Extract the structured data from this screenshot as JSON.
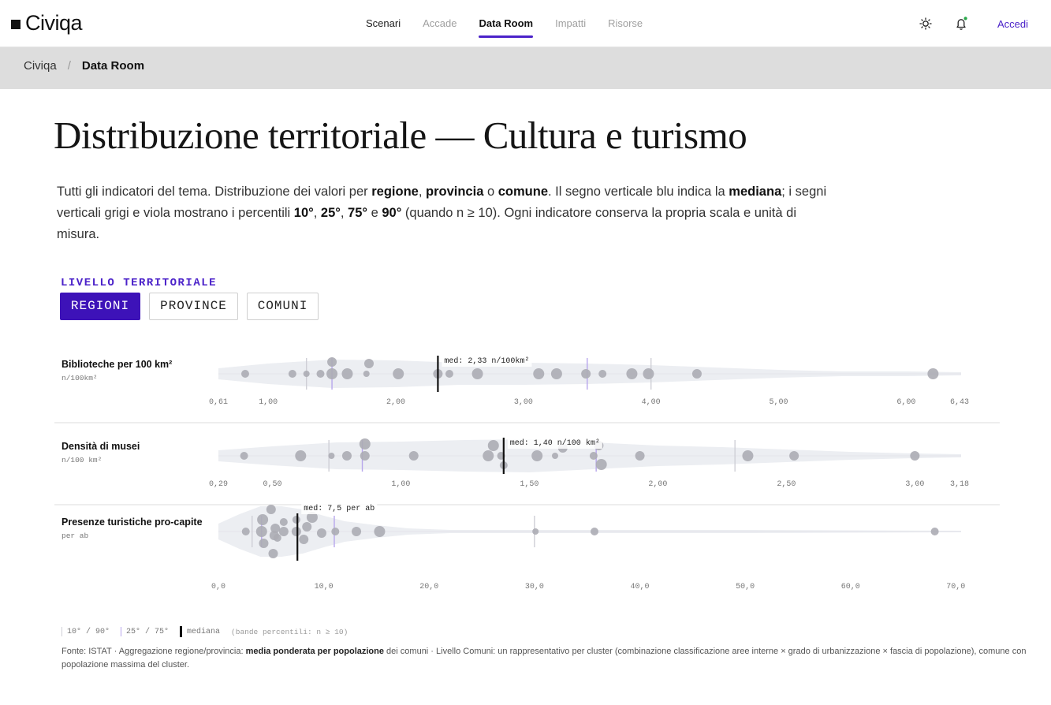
{
  "brand": {
    "name": "Civiqa"
  },
  "nav": {
    "items": [
      {
        "label": "Scenari",
        "state": "dark"
      },
      {
        "label": "Accade",
        "state": "muted"
      },
      {
        "label": "Data Room",
        "state": "active"
      },
      {
        "label": "Impatti",
        "state": "muted"
      },
      {
        "label": "Risorse",
        "state": "muted"
      }
    ],
    "login_label": "Accedi",
    "accent_color": "#4b22c9"
  },
  "icons": {
    "theme": "sun-icon",
    "notifications": "bell-icon",
    "notification_dot_color": "#2aa84a"
  },
  "breadcrumb": {
    "home": "Civiqa",
    "separator": "/",
    "current": "Data Room"
  },
  "page": {
    "title": "Distribuzione territoriale — Cultura e turismo",
    "intro": {
      "t1": "Tutti gli indicatori del tema. Distribuzione dei valori per ",
      "b1": "regione",
      "t2": ", ",
      "b2": "provincia",
      "t3": " o ",
      "b3": "comune",
      "t4": ". Il segno verticale blu indica la ",
      "b4": "mediana",
      "t5": "; i segni verticali grigi e viola mostrano i percentili ",
      "b5": "10°",
      "t6": ", ",
      "b6": "25°",
      "t7": ", ",
      "b7": "75°",
      "t8": " e ",
      "b8": "90°",
      "t9": " (quando n ≥ 10). Ogni indicatore conserva la propria scala e unità di misura."
    }
  },
  "level": {
    "label": "LIVELLO TERRITORIALE",
    "options": [
      "REGIONI",
      "PROVINCE",
      "COMUNI"
    ],
    "selected": "REGIONI"
  },
  "chart_data": {
    "type": "scatter",
    "subtype": "beeswarm-violin",
    "colors": {
      "dot": "#acacb4",
      "violin": "#eceef2",
      "median": "#111111",
      "p10_p90": "#cfcfd6",
      "p25_p75": "#b7a6ec"
    },
    "indicators": [
      {
        "name": "Biblioteche per 100 km²",
        "unit": "n/100km²",
        "xlim": [
          0.61,
          6.43
        ],
        "ticks": [
          0.61,
          1.0,
          2.0,
          3.0,
          4.0,
          5.0,
          6.0,
          6.43
        ],
        "tick_labels": [
          "0,61",
          "1,00",
          "2,00",
          "3,00",
          "4,00",
          "5,00",
          "6,00",
          "6,43"
        ],
        "median": 2.33,
        "median_label": "med: 2,33 n/100km²",
        "percentiles": {
          "p10": 1.3,
          "p25": 1.5,
          "p75": 3.5,
          "p90": 4.0
        },
        "violin_halfwidth": [
          [
            0.61,
            7
          ],
          [
            1.0,
            13
          ],
          [
            1.5,
            18
          ],
          [
            2.0,
            17
          ],
          [
            2.5,
            14
          ],
          [
            3.0,
            14
          ],
          [
            3.5,
            13
          ],
          [
            4.0,
            11
          ],
          [
            4.5,
            8
          ],
          [
            5.0,
            5
          ],
          [
            5.5,
            3
          ],
          [
            6.0,
            3
          ],
          [
            6.43,
            2
          ]
        ],
        "points": [
          {
            "x": 0.82,
            "dy": 0,
            "r": 5
          },
          {
            "x": 1.19,
            "dy": 0,
            "r": 5
          },
          {
            "x": 1.3,
            "dy": 0,
            "r": 4
          },
          {
            "x": 1.41,
            "dy": 0,
            "r": 5
          },
          {
            "x": 1.5,
            "dy": 0,
            "r": 7
          },
          {
            "x": 1.5,
            "dy": -15,
            "r": 6
          },
          {
            "x": 1.62,
            "dy": 0,
            "r": 7
          },
          {
            "x": 1.77,
            "dy": 0,
            "r": 4
          },
          {
            "x": 1.79,
            "dy": -13,
            "r": 6
          },
          {
            "x": 2.02,
            "dy": 0,
            "r": 7
          },
          {
            "x": 2.33,
            "dy": 0,
            "r": 6
          },
          {
            "x": 2.42,
            "dy": 0,
            "r": 5
          },
          {
            "x": 2.64,
            "dy": 0,
            "r": 7
          },
          {
            "x": 3.12,
            "dy": 0,
            "r": 7
          },
          {
            "x": 3.26,
            "dy": 0,
            "r": 7
          },
          {
            "x": 3.49,
            "dy": 0,
            "r": 6
          },
          {
            "x": 3.62,
            "dy": 0,
            "r": 5
          },
          {
            "x": 3.85,
            "dy": 0,
            "r": 7
          },
          {
            "x": 3.98,
            "dy": 0,
            "r": 7
          },
          {
            "x": 4.36,
            "dy": 0,
            "r": 6
          },
          {
            "x": 6.21,
            "dy": 0,
            "r": 7
          }
        ]
      },
      {
        "name": "Densità di musei",
        "unit": "n/100 km²",
        "xlim": [
          0.29,
          3.18
        ],
        "ticks": [
          0.29,
          0.5,
          1.0,
          1.5,
          2.0,
          2.5,
          3.0,
          3.18
        ],
        "tick_labels": [
          "0,29",
          "0,50",
          "1,00",
          "1,50",
          "2,00",
          "2,50",
          "3,00",
          "3,18"
        ],
        "median": 1.4,
        "median_label": "med: 1,40 n/100 km²",
        "percentiles": {
          "p10": 0.72,
          "p25": 0.85,
          "p75": 1.76,
          "p90": 2.3
        },
        "violin_halfwidth": [
          [
            0.29,
            7
          ],
          [
            0.5,
            12
          ],
          [
            0.75,
            17
          ],
          [
            1.0,
            18
          ],
          [
            1.25,
            20
          ],
          [
            1.5,
            21
          ],
          [
            1.75,
            17
          ],
          [
            2.0,
            13
          ],
          [
            2.25,
            11
          ],
          [
            2.5,
            8
          ],
          [
            2.75,
            5
          ],
          [
            3.0,
            3
          ],
          [
            3.18,
            2
          ]
        ],
        "points": [
          {
            "x": 0.39,
            "dy": 0,
            "r": 5
          },
          {
            "x": 0.61,
            "dy": 0,
            "r": 7
          },
          {
            "x": 0.73,
            "dy": 0,
            "r": 4
          },
          {
            "x": 0.79,
            "dy": 0,
            "r": 6
          },
          {
            "x": 0.86,
            "dy": 0,
            "r": 6
          },
          {
            "x": 0.86,
            "dy": -15,
            "r": 7
          },
          {
            "x": 1.05,
            "dy": 0,
            "r": 6
          },
          {
            "x": 1.34,
            "dy": 0,
            "r": 7
          },
          {
            "x": 1.36,
            "dy": -13,
            "r": 7
          },
          {
            "x": 1.39,
            "dy": 0,
            "r": 5
          },
          {
            "x": 1.4,
            "dy": 12,
            "r": 5
          },
          {
            "x": 1.53,
            "dy": 0,
            "r": 7
          },
          {
            "x": 1.6,
            "dy": 0,
            "r": 4
          },
          {
            "x": 1.63,
            "dy": -10,
            "r": 6
          },
          {
            "x": 1.75,
            "dy": 0,
            "r": 5
          },
          {
            "x": 1.77,
            "dy": -13,
            "r": 6
          },
          {
            "x": 1.78,
            "dy": 11,
            "r": 7
          },
          {
            "x": 1.93,
            "dy": 0,
            "r": 6
          },
          {
            "x": 2.35,
            "dy": 0,
            "r": 7
          },
          {
            "x": 2.53,
            "dy": 0,
            "r": 6
          },
          {
            "x": 3.0,
            "dy": 0,
            "r": 6
          }
        ]
      },
      {
        "name": "Presenze turistiche pro-capite",
        "unit": "per ab",
        "xlim": [
          0,
          70.5
        ],
        "ticks": [
          0,
          10,
          20,
          30,
          40,
          50,
          60,
          70
        ],
        "tick_labels": [
          "0,0",
          "10,0",
          "20,0",
          "30,0",
          "40,0",
          "50,0",
          "60,0",
          "70,0"
        ],
        "median": 7.5,
        "median_label": "med: 7,5 per ab",
        "percentiles": {
          "p10": 3.2,
          "p25": 4.1,
          "p75": 11.0,
          "p90": 30.0
        },
        "violin_halfwidth": [
          [
            0,
            10
          ],
          [
            2,
            22
          ],
          [
            4,
            32
          ],
          [
            6,
            32
          ],
          [
            8,
            28
          ],
          [
            10,
            20
          ],
          [
            12,
            13
          ],
          [
            15,
            8
          ],
          [
            18,
            4
          ],
          [
            22,
            2
          ],
          [
            30,
            2
          ],
          [
            50,
            2
          ],
          [
            70.5,
            1
          ]
        ],
        "points": [
          {
            "x": 2.6,
            "dy": 0,
            "r": 5
          },
          {
            "x": 4.1,
            "dy": 0,
            "r": 7
          },
          {
            "x": 4.2,
            "dy": -15,
            "r": 7
          },
          {
            "x": 4.3,
            "dy": 15,
            "r": 6
          },
          {
            "x": 5.0,
            "dy": -28,
            "r": 6
          },
          {
            "x": 5.2,
            "dy": 28,
            "r": 6
          },
          {
            "x": 5.3,
            "dy": 5,
            "r": 6
          },
          {
            "x": 5.4,
            "dy": -4,
            "r": 6
          },
          {
            "x": 5.6,
            "dy": 8,
            "r": 5
          },
          {
            "x": 6.2,
            "dy": 0,
            "r": 6
          },
          {
            "x": 6.2,
            "dy": -12,
            "r": 5
          },
          {
            "x": 7.4,
            "dy": 0,
            "r": 6
          },
          {
            "x": 7.4,
            "dy": -15,
            "r": 5
          },
          {
            "x": 8.1,
            "dy": 10,
            "r": 6
          },
          {
            "x": 8.4,
            "dy": -6,
            "r": 6
          },
          {
            "x": 8.9,
            "dy": -18,
            "r": 7
          },
          {
            "x": 9.8,
            "dy": 2,
            "r": 6
          },
          {
            "x": 11.1,
            "dy": 0,
            "r": 5
          },
          {
            "x": 13.1,
            "dy": 0,
            "r": 6
          },
          {
            "x": 15.3,
            "dy": 0,
            "r": 7
          },
          {
            "x": 30.1,
            "dy": 0,
            "r": 4
          },
          {
            "x": 35.7,
            "dy": 0,
            "r": 5
          },
          {
            "x": 68.0,
            "dy": 0,
            "r": 5
          }
        ]
      }
    ]
  },
  "legend": {
    "p10_90": "10° / 90°",
    "p25_75": "25° / 75°",
    "median": "mediana",
    "note": "(bande percentili: n ≥ 10)"
  },
  "source": {
    "t1": "Fonte: ISTAT · Aggregazione regione/provincia: ",
    "b1": "media ponderata per popolazione",
    "t2": " dei comuni · Livello Comuni: un rappresentativo per cluster (combinazione classificazione aree interne × grado di urbanizzazione × fascia di popolazione), comune con popolazione massima del cluster."
  }
}
